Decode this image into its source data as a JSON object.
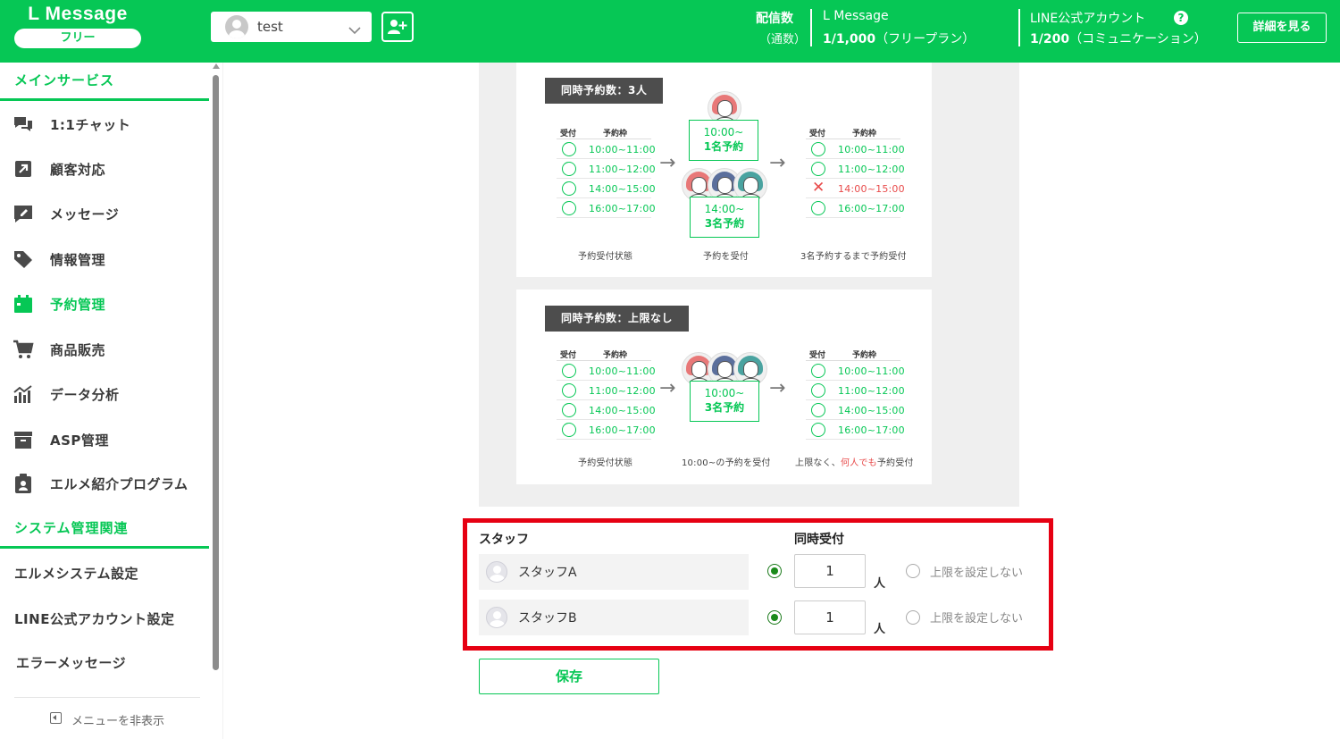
{
  "header": {
    "logo": "L Message",
    "plan": "フリー",
    "account_name": "test",
    "delivery_label": "配信数",
    "delivery_sub": "（通数）",
    "lmsg_title": "L Message",
    "lmsg_count": "1/1,000",
    "lmsg_plan": "（フリープラン）",
    "line_title": "LINE公式アカウント",
    "line_count": "1/200",
    "line_plan": "（コミュニケーション）",
    "help_icon": "?",
    "detail_button": "詳細を見る"
  },
  "sidebar": {
    "main_section": "メインサービス",
    "items": [
      {
        "label": "1:1チャット",
        "icon": "chat-icon"
      },
      {
        "label": "顧客対応",
        "icon": "arrow-box-icon"
      },
      {
        "label": "メッセージ",
        "icon": "message-edit-icon"
      },
      {
        "label": "情報管理",
        "icon": "tag-icon"
      },
      {
        "label": "予約管理",
        "icon": "calendar-icon",
        "active": true
      },
      {
        "label": "商品販売",
        "icon": "cart-icon"
      },
      {
        "label": "データ分析",
        "icon": "chart-icon"
      },
      {
        "label": "ASP管理",
        "icon": "archive-icon"
      },
      {
        "label": "エルメ紹介プログラム",
        "icon": "clipboard-icon"
      }
    ],
    "system_section": "システム管理関連",
    "system_items": [
      "エルメシステム設定",
      "LINE公式アカウント設定",
      "エラーメッセージ"
    ],
    "hide_menu": "メニューを非表示"
  },
  "diagram": {
    "card1": {
      "badge": "同時予約数：3人",
      "col_accept": "受付",
      "col_slot": "予約枠",
      "slots": [
        "10:00~11:00",
        "11:00~12:00",
        "14:00~15:00",
        "16:00~17:00"
      ],
      "box1_time": "10:00~",
      "box1_count": "1名予約",
      "box2_time": "14:00~",
      "box2_count": "3名予約",
      "caption_left": "予約受付状態",
      "caption_mid": "予約を受付",
      "caption_right": "3名予約するまで予約受付"
    },
    "card2": {
      "badge": "同時予約数：上限なし",
      "col_accept": "受付",
      "col_slot": "予約枠",
      "slots": [
        "10:00~11:00",
        "11:00~12:00",
        "14:00~15:00",
        "16:00~17:00"
      ],
      "box_time": "10:00~",
      "box_count": "3名予約",
      "caption_left": "予約受付状態",
      "caption_mid": "10:00~の予約を受付",
      "caption_right_a": "上限なく、",
      "caption_right_b": "何人でも",
      "caption_right_c": "予約受付"
    }
  },
  "staff_form": {
    "col_staff": "スタッフ",
    "col_concurrent": "同時受付",
    "rows": [
      {
        "name": "スタッフA",
        "value": "1",
        "unit": "人",
        "nolimit": "上限を設定しない"
      },
      {
        "name": "スタッフB",
        "value": "1",
        "unit": "人",
        "nolimit": "上限を設定しない"
      }
    ],
    "save": "保存"
  }
}
